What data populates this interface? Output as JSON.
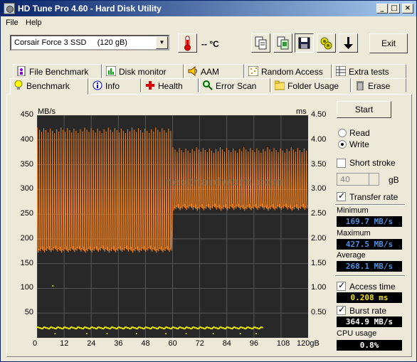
{
  "window": {
    "title": "HD Tune Pro 4.60 - Hard Disk Utility",
    "controls": {
      "minimize": "_",
      "maximize": "□",
      "close": "×"
    }
  },
  "menu": [
    "File",
    "Help"
  ],
  "toolbar": {
    "drive": "Corsair Force 3 SSD     (120 gB)",
    "temperature": "-- °C",
    "exit_label": "Exit",
    "icons": [
      "thermometer-icon",
      "copy-icon",
      "copy-screen-icon",
      "save-icon",
      "options-icon",
      "download-icon"
    ]
  },
  "tabs_row1": [
    "File Benchmark",
    "Disk monitor",
    "AAM",
    "Random Access",
    "Extra tests"
  ],
  "tabs_row2": [
    "Benchmark",
    "Info",
    "Health",
    "Error Scan",
    "Folder Usage",
    "Erase"
  ],
  "active_tab": "Benchmark",
  "controls": {
    "start_label": "Start",
    "mode_read": "Read",
    "mode_write": "Write",
    "selected_mode": "Write",
    "short_stroke_label": "Short stroke",
    "short_stroke_value": "40",
    "short_stroke_unit": "gB",
    "transfer_rate_label": "Transfer rate",
    "access_time_label": "Access time",
    "burst_rate_label": "Burst rate"
  },
  "results": {
    "minimum_label": "Minimum",
    "minimum": "169.7 MB/s",
    "maximum_label": "Maximum",
    "maximum": "427.5 MB/s",
    "average_label": "Average",
    "average": "268.1 MB/s",
    "access_time": "0.208 ms",
    "burst_rate": "364.9 MB/s",
    "cpu_label": "CPU usage",
    "cpu_usage": "0.8%"
  },
  "watermark": "nexthardware.com",
  "chart_data": {
    "type": "line",
    "x_unit": "gB",
    "y_left_unit": "MB/s",
    "y_right_unit": "ms",
    "y_left_ticks": [
      450,
      400,
      350,
      300,
      250,
      200,
      150,
      100,
      50
    ],
    "y_right_ticks": [
      "4.50",
      "4.00",
      "3.50",
      "3.00",
      "2.50",
      "2.00",
      "1.50",
      "1.00",
      "0.50"
    ],
    "x_ticks": [
      0,
      12,
      24,
      36,
      48,
      60,
      72,
      84,
      96,
      108
    ],
    "x_last_tick": "120gB",
    "xlim": [
      0,
      120
    ],
    "ylim": [
      0,
      450
    ],
    "y2lim": [
      0,
      4.5
    ],
    "series": [
      {
        "color": "#f08020",
        "segments": [
          {
            "x_start": 0,
            "x_end": 60,
            "low": 175,
            "high": 425
          },
          {
            "x_start": 60,
            "x_end": 120,
            "low": 260,
            "high": 385
          }
        ]
      },
      {
        "color": "#e8e800",
        "values": [
          0.2
        ]
      }
    ]
  }
}
